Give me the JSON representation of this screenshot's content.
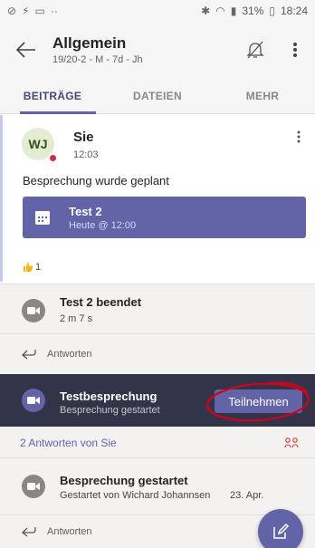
{
  "statusbar": {
    "battery": "31%",
    "time": "18:24"
  },
  "header": {
    "title": "Allgemein",
    "subtitle": "19/20-2 - M - 7d - Jh"
  },
  "tabs": [
    {
      "label": "BEITRÄGE"
    },
    {
      "label": "DATEIEN"
    },
    {
      "label": "MEHR"
    }
  ],
  "post": {
    "avatar_initials": "WJ",
    "author": "Sie",
    "time": "12:03",
    "text": "Besprechung wurde geplant",
    "meeting_card": {
      "title": "Test 2",
      "subtitle": "Heute @ 12:00"
    },
    "reaction_count": "1"
  },
  "ended": {
    "title": "Test 2 beendet",
    "duration": "2 m 7 s",
    "reply_label": "Antworten"
  },
  "banner": {
    "title": "Testbesprechung",
    "subtitle": "Besprechung gestartet",
    "join_label": "Teilnehmen"
  },
  "replies": {
    "label": "2 Antworten von Sie"
  },
  "started": {
    "title": "Besprechung gestartet",
    "subtitle": "Gestartet von Wichard Johannsen",
    "date": "23. Apr.",
    "reply_label": "Antworten"
  },
  "colors": {
    "accent": "#6264a7",
    "banner": "#33344a",
    "presence": "#c4314b",
    "annotation": "#d0021b"
  },
  "icons": [
    "back-arrow-icon",
    "bell-off-icon",
    "more-vertical-icon",
    "calendar-icon",
    "thumbs-up-icon",
    "camera-icon",
    "reply-icon",
    "people-icon",
    "compose-icon"
  ]
}
